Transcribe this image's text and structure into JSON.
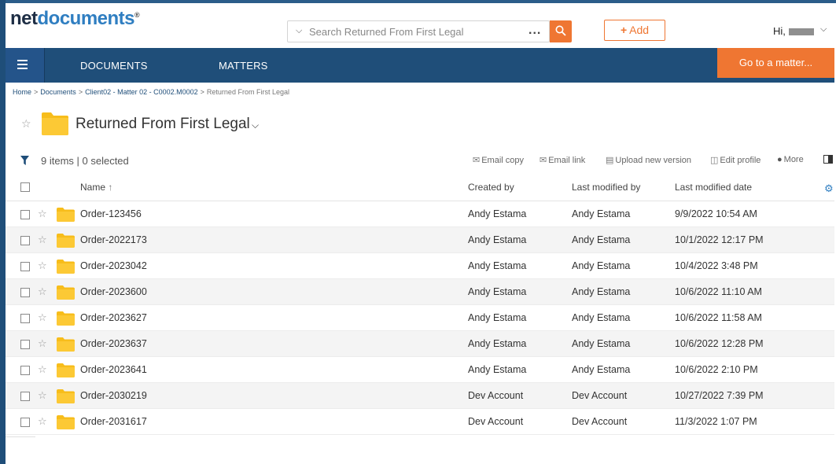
{
  "brand": {
    "net": "net",
    "docs": "documents",
    "reg": "®"
  },
  "search": {
    "placeholder": "Search Returned From First Legal",
    "more": "..."
  },
  "add_button": {
    "plus": "+",
    "label": "Add"
  },
  "user": {
    "greeting": "Hi,"
  },
  "nav": {
    "documents": "DOCUMENTS",
    "matters": "MATTERS",
    "goto": "Go to a matter..."
  },
  "breadcrumb": {
    "home": "Home",
    "documents": "Documents",
    "client": "Client02 - Matter 02 - C0002.M0002",
    "current": "Returned From First Legal",
    "sep": ">"
  },
  "page": {
    "title": "Returned From First Legal"
  },
  "toolbar": {
    "count": "9 items | 0 selected",
    "email_copy": "Email copy",
    "email_link": "Email link",
    "upload_new_version": "Upload new version",
    "edit_profile": "Edit profile",
    "more": "More"
  },
  "table": {
    "headers": {
      "name": "Name",
      "sort_arrow": "↑",
      "created_by": "Created by",
      "last_modified_by": "Last modified by",
      "last_modified_date": "Last modified date"
    },
    "rows": [
      {
        "name": "Order-123456",
        "created_by": "Andy Estama",
        "modified_by": "Andy Estama",
        "modified_date": "9/9/2022 10:54 AM"
      },
      {
        "name": "Order-2022173",
        "created_by": "Andy Estama",
        "modified_by": "Andy Estama",
        "modified_date": "10/1/2022 12:17 PM"
      },
      {
        "name": "Order-2023042",
        "created_by": "Andy Estama",
        "modified_by": "Andy Estama",
        "modified_date": "10/4/2022 3:48 PM"
      },
      {
        "name": "Order-2023600",
        "created_by": "Andy Estama",
        "modified_by": "Andy Estama",
        "modified_date": "10/6/2022 11:10 AM"
      },
      {
        "name": "Order-2023627",
        "created_by": "Andy Estama",
        "modified_by": "Andy Estama",
        "modified_date": "10/6/2022 11:58 AM"
      },
      {
        "name": "Order-2023637",
        "created_by": "Andy Estama",
        "modified_by": "Andy Estama",
        "modified_date": "10/6/2022 12:28 PM"
      },
      {
        "name": "Order-2023641",
        "created_by": "Andy Estama",
        "modified_by": "Andy Estama",
        "modified_date": "10/6/2022 2:10 PM"
      },
      {
        "name": "Order-2030219",
        "created_by": "Dev Account",
        "modified_by": "Dev Account",
        "modified_date": "10/27/2022 7:39 PM"
      },
      {
        "name": "Order-2031617",
        "created_by": "Dev Account",
        "modified_by": "Dev Account",
        "modified_date": "11/3/2022 1:07 PM"
      }
    ]
  },
  "icons": {
    "search": "search-icon",
    "menu": "hamburger-menu-icon",
    "star": "star-icon",
    "folder": "folder-icon",
    "filter": "filter-icon",
    "gear": "gear-icon",
    "panel": "panel-toggle-icon",
    "chevron": "chevron-down-icon"
  },
  "colors": {
    "accent": "#ef7632",
    "nav": "#1f4e79",
    "brand_blue": "#2f7ec1",
    "folder": "#f7bd1b"
  }
}
